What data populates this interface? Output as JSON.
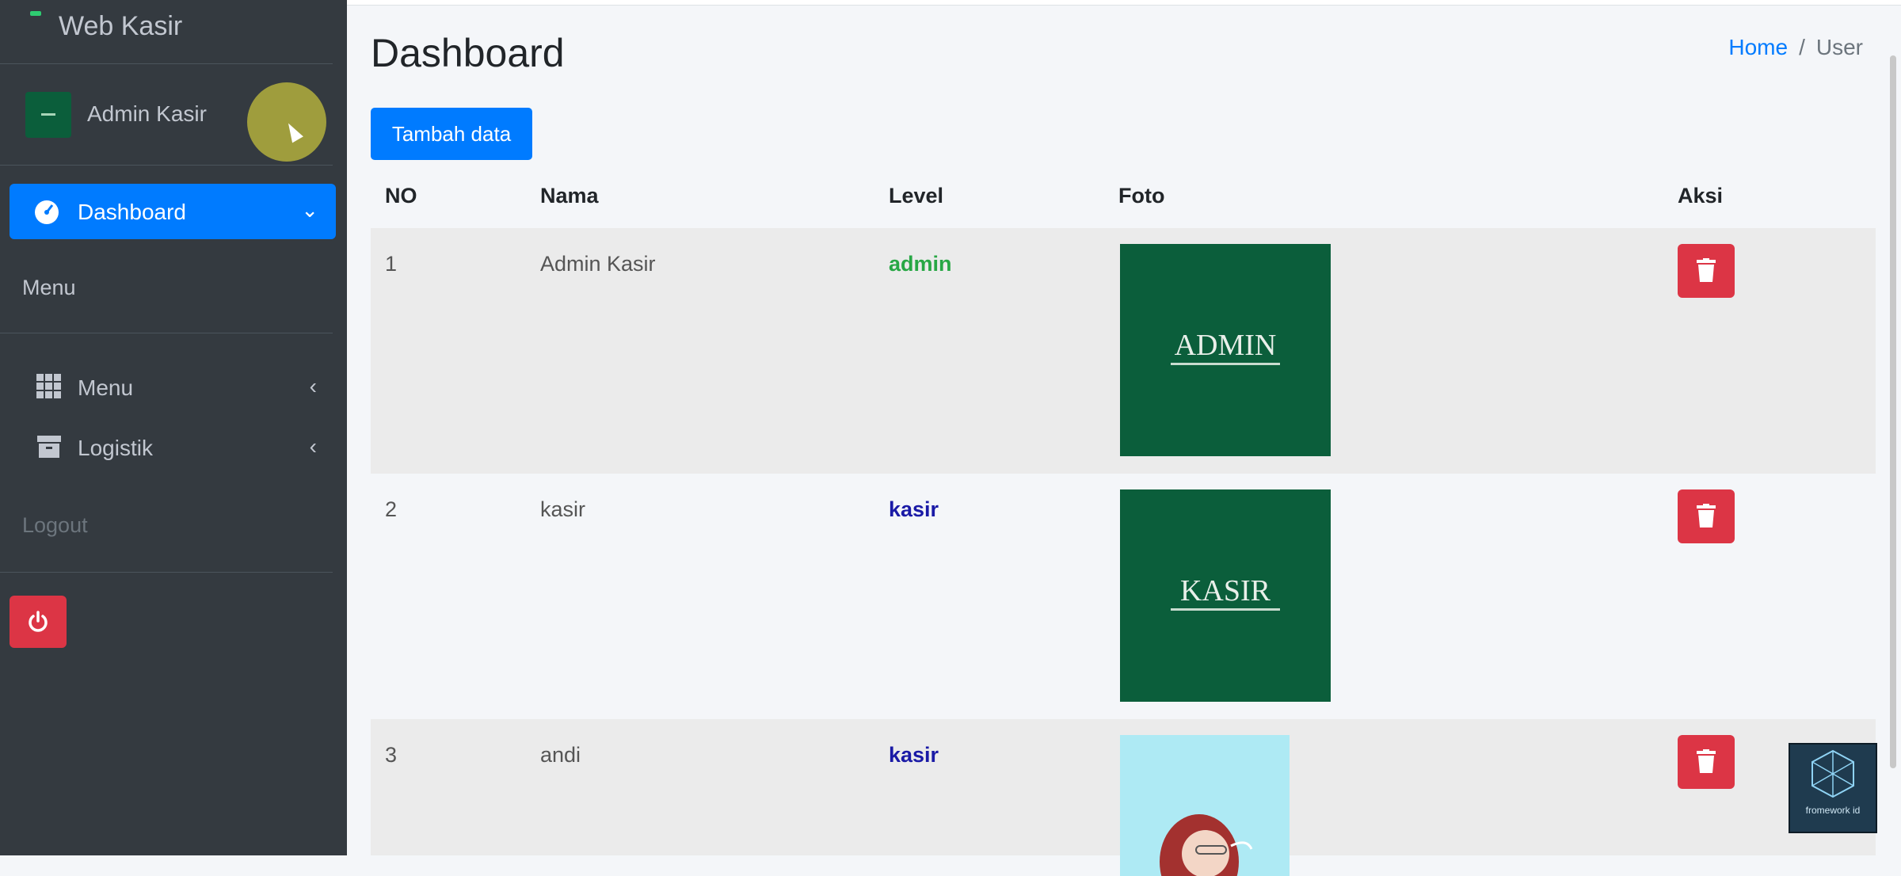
{
  "sidebar": {
    "brand": "Web Kasir",
    "user_name": "Admin Kasir",
    "active_item": "Dashboard",
    "section_label": "Menu",
    "items": [
      {
        "label": "Menu",
        "icon": "grid-icon"
      },
      {
        "label": "Logistik",
        "icon": "archive-icon"
      }
    ],
    "logout": "Logout"
  },
  "page": {
    "title": "Dashboard",
    "breadcrumb": {
      "home": "Home",
      "separator": "/",
      "current": "User"
    },
    "add_button": "Tambah data"
  },
  "table": {
    "headers": {
      "no": "NO",
      "nama": "Nama",
      "level": "Level",
      "foto": "Foto",
      "aksi": "Aksi"
    },
    "rows": [
      {
        "no": "1",
        "nama": "Admin Kasir",
        "level": "admin",
        "level_color": "#28a745",
        "foto_text": "ADMIN"
      },
      {
        "no": "2",
        "nama": "kasir",
        "level": "kasir",
        "level_color": "#1a1aa6",
        "foto_text": "KASIR"
      },
      {
        "no": "3",
        "nama": "andi",
        "level": "kasir",
        "level_color": "#1a1aa6",
        "foto_text": ""
      }
    ]
  },
  "watermark": {
    "text": "fromework id"
  },
  "colors": {
    "primary": "#007bff",
    "danger": "#dc3545",
    "sidebar": "#343a40",
    "photo_green": "#0b5e3b"
  }
}
